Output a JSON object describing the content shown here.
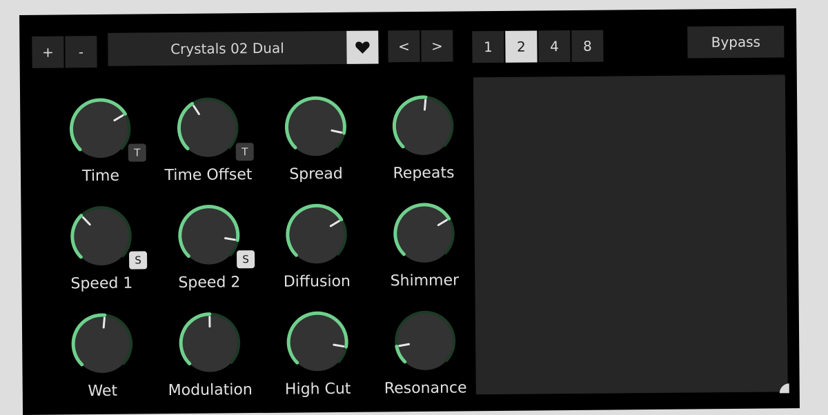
{
  "toolbar": {
    "add_label": "+",
    "remove_label": "-",
    "preset_name": "Crystals 02 Dual",
    "prev_label": "<",
    "next_label": ">",
    "bypass_label": "Bypass"
  },
  "divisions": [
    {
      "label": "1",
      "active": false
    },
    {
      "label": "2",
      "active": true
    },
    {
      "label": "4",
      "active": false
    },
    {
      "label": "8",
      "active": false
    }
  ],
  "colors": {
    "accent": "#6fd08d",
    "knob_face": "#333333",
    "knob_track": "#1d3a26",
    "panel": "#262626"
  },
  "knobs": [
    {
      "label": "Time",
      "value": 0.72,
      "tag": "T"
    },
    {
      "label": "Time Offset",
      "value": 0.38,
      "tag": "T"
    },
    {
      "label": "Spread",
      "value": 0.88,
      "tag": ""
    },
    {
      "label": "Repeats",
      "value": 0.52,
      "tag": ""
    },
    {
      "label": "Speed 1",
      "value": 0.34,
      "tag": "S"
    },
    {
      "label": "Speed 2",
      "value": 0.87,
      "tag": "S"
    },
    {
      "label": "Diffusion",
      "value": 0.72,
      "tag": ""
    },
    {
      "label": "Shimmer",
      "value": 0.72,
      "tag": ""
    },
    {
      "label": "Wet",
      "value": 0.52,
      "tag": ""
    },
    {
      "label": "Modulation",
      "value": 0.5,
      "tag": ""
    },
    {
      "label": "High Cut",
      "value": 0.87,
      "tag": ""
    },
    {
      "label": "Resonance",
      "value": 0.13,
      "tag": ""
    }
  ]
}
